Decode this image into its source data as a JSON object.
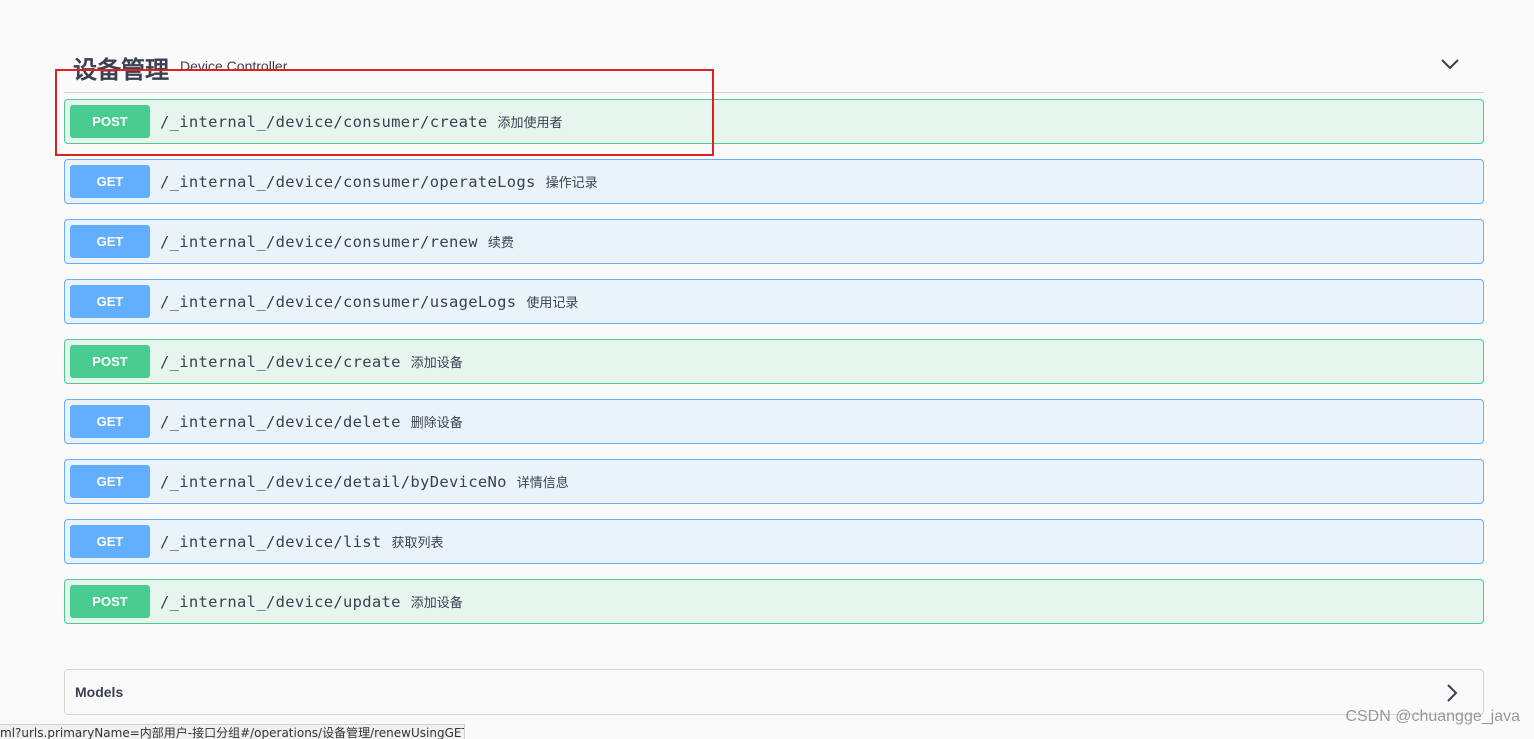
{
  "section": {
    "title": "设备管理",
    "description": "Device Controller"
  },
  "operations": [
    {
      "method": "POST",
      "path": "/_internal_/device/consumer/create",
      "summary": "添加使用者"
    },
    {
      "method": "GET",
      "path": "/_internal_/device/consumer/operateLogs",
      "summary": "操作记录"
    },
    {
      "method": "GET",
      "path": "/_internal_/device/consumer/renew",
      "summary": "续费"
    },
    {
      "method": "GET",
      "path": "/_internal_/device/consumer/usageLogs",
      "summary": "使用记录"
    },
    {
      "method": "POST",
      "path": "/_internal_/device/create",
      "summary": "添加设备"
    },
    {
      "method": "GET",
      "path": "/_internal_/device/delete",
      "summary": "删除设备"
    },
    {
      "method": "GET",
      "path": "/_internal_/device/detail/byDeviceNo",
      "summary": "详情信息"
    },
    {
      "method": "GET",
      "path": "/_internal_/device/list",
      "summary": "获取列表"
    },
    {
      "method": "POST",
      "path": "/_internal_/device/update",
      "summary": "添加设备"
    }
  ],
  "models": {
    "title": "Models"
  },
  "status_bar": {
    "url": "ml?urls.primaryName=内部用户-接口分组#/operations/设备管理/renewUsingGET"
  },
  "watermark": "CSDN @chuangge_java",
  "colors": {
    "post": "#49cc90",
    "get": "#61affe",
    "highlight": "#e02020"
  }
}
